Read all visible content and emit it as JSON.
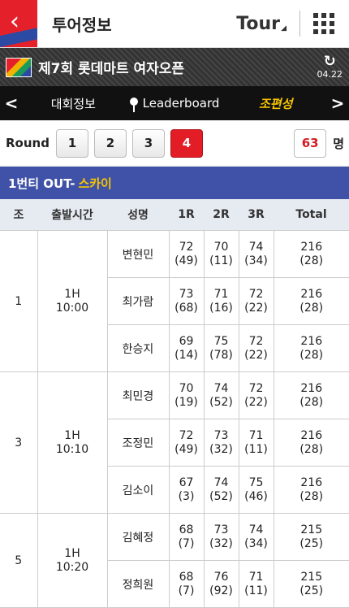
{
  "header": {
    "title": "투어정보",
    "tour_label": "Tour"
  },
  "event": {
    "name": "제7회 롯데마트 여자오픈",
    "date": "04.22"
  },
  "subnav": {
    "prev": "<",
    "items": [
      "대회정보",
      "Leaderboard",
      "조편성"
    ],
    "selected_index": 2,
    "next": ">"
  },
  "round": {
    "label": "Round",
    "buttons": [
      "1",
      "2",
      "3",
      "4"
    ],
    "active": "4",
    "count": "63",
    "count_unit": "명"
  },
  "section": {
    "prefix": "1번티 OUT-",
    "course": "스카이"
  },
  "table": {
    "headers": [
      "조",
      "출발시간",
      "성명",
      "1R",
      "2R",
      "3R",
      "Total"
    ],
    "groups": [
      {
        "group": "1",
        "tee": "1H",
        "time": "10:00",
        "players": [
          {
            "name": "변현민",
            "r1": "72",
            "r1_rank": "(49)",
            "r2": "70",
            "r2_rank": "(11)",
            "r3": "74",
            "r3_rank": "(34)",
            "total": "216",
            "total_rank": "(28)"
          },
          {
            "name": "최가람",
            "r1": "73",
            "r1_rank": "(68)",
            "r2": "71",
            "r2_rank": "(16)",
            "r3": "72",
            "r3_rank": "(22)",
            "total": "216",
            "total_rank": "(28)"
          },
          {
            "name": "한승지",
            "r1": "69",
            "r1_rank": "(14)",
            "r2": "75",
            "r2_rank": "(78)",
            "r3": "72",
            "r3_rank": "(22)",
            "total": "216",
            "total_rank": "(28)"
          }
        ]
      },
      {
        "group": "3",
        "tee": "1H",
        "time": "10:10",
        "players": [
          {
            "name": "최민경",
            "r1": "70",
            "r1_rank": "(19)",
            "r2": "74",
            "r2_rank": "(52)",
            "r3": "72",
            "r3_rank": "(22)",
            "total": "216",
            "total_rank": "(28)"
          },
          {
            "name": "조정민",
            "r1": "72",
            "r1_rank": "(49)",
            "r2": "73",
            "r2_rank": "(32)",
            "r3": "71",
            "r3_rank": "(11)",
            "total": "216",
            "total_rank": "(28)"
          },
          {
            "name": "김소이",
            "r1": "67",
            "r1_rank": "(3)",
            "r2": "74",
            "r2_rank": "(52)",
            "r3": "75",
            "r3_rank": "(46)",
            "total": "216",
            "total_rank": "(28)"
          }
        ]
      },
      {
        "group": "5",
        "tee": "1H",
        "time": "10:20",
        "players": [
          {
            "name": "김혜정",
            "r1": "68",
            "r1_rank": "(7)",
            "r2": "73",
            "r2_rank": "(32)",
            "r3": "74",
            "r3_rank": "(34)",
            "total": "215",
            "total_rank": "(25)"
          },
          {
            "name": "정희원",
            "r1": "68",
            "r1_rank": "(7)",
            "r2": "76",
            "r2_rank": "(92)",
            "r3": "71",
            "r3_rank": "(11)",
            "total": "215",
            "total_rank": "(25)"
          }
        ]
      }
    ]
  },
  "colors": {
    "accent_red": "#e21d25",
    "section_blue": "#3f52a8",
    "highlight_yellow": "#f5c400"
  }
}
